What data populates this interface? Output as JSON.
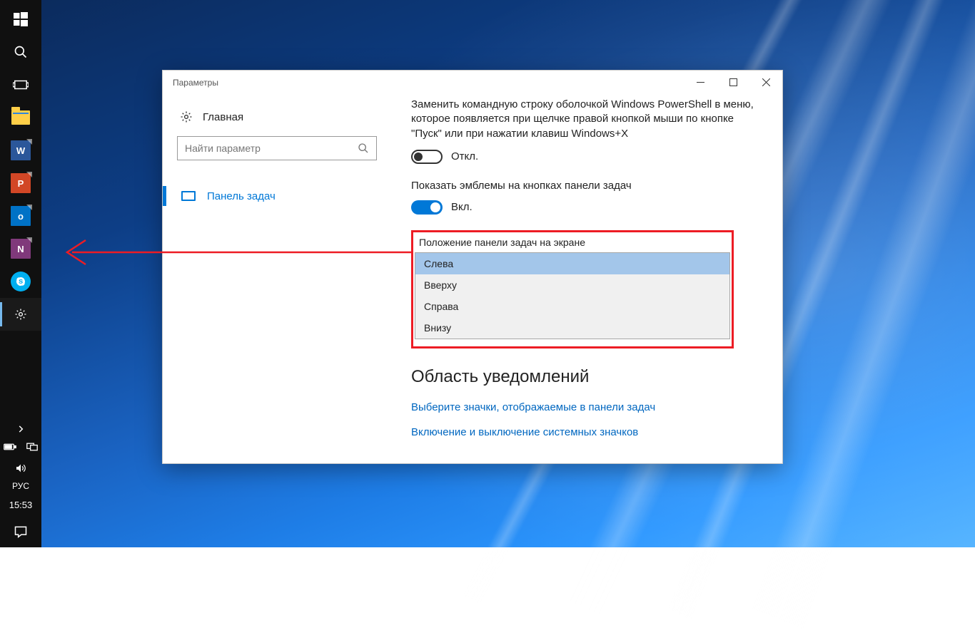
{
  "taskbar": {
    "apps": {
      "word": "W",
      "powerpoint": "P",
      "outlook": "o",
      "onenote": "N"
    },
    "lang": "РУС",
    "clock": "15:53"
  },
  "window": {
    "title": "Параметры",
    "sidebar": {
      "home": "Главная",
      "search_placeholder": "Найти параметр",
      "item_taskbar": "Панель задач"
    },
    "content": {
      "powershell_desc": "Заменить командную строку оболочкой Windows PowerShell в меню, которое появляется при щелчке правой кнопкой мыши по кнопке \"Пуск\" или при нажатии клавиш Windows+X",
      "off_label": "Откл.",
      "badges_label": "Показать эмблемы на кнопках панели задач",
      "on_label": "Вкл.",
      "position_title": "Положение панели задач на экране",
      "options": {
        "left": "Слева",
        "top": "Вверху",
        "right": "Справа",
        "bottom": "Внизу"
      },
      "notif_heading": "Область уведомлений",
      "link_icons": "Выберите значки, отображаемые в панели задач",
      "link_sysicons": "Включение и выключение системных значков"
    }
  }
}
